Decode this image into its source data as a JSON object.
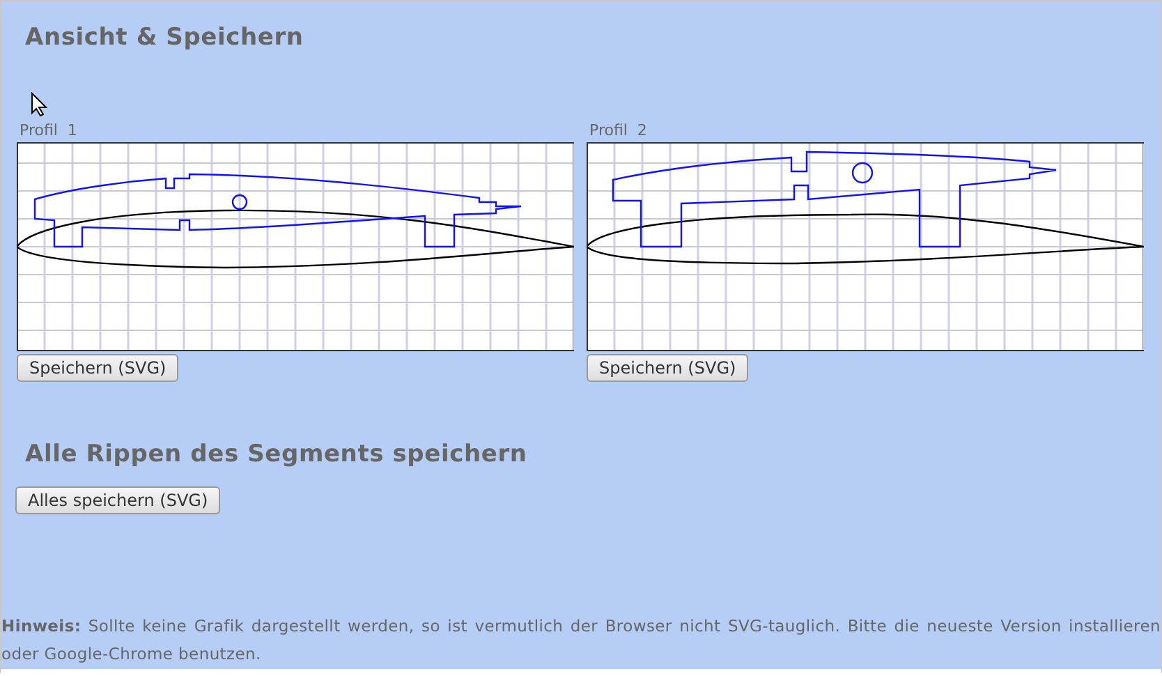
{
  "heading": "Ansicht & Speichern",
  "profiles": [
    {
      "label": "Profil  1",
      "button": "Speichern (SVG)",
      "kind": "profile1"
    },
    {
      "label": "Profil  2",
      "button": "Speichern (SVG)",
      "kind": "profile2"
    }
  ],
  "all_section": {
    "heading": "Alle Rippen des Segments speichern",
    "button": "Alles speichern (SVG)"
  },
  "hint": "**Hinweis:** Sollte keine Grafik dargestellt werden, so ist vermutlich der Browser nicht SVG-tauglich. Bitte die neueste Version installieren oder Google-Chrome benutzen."
}
